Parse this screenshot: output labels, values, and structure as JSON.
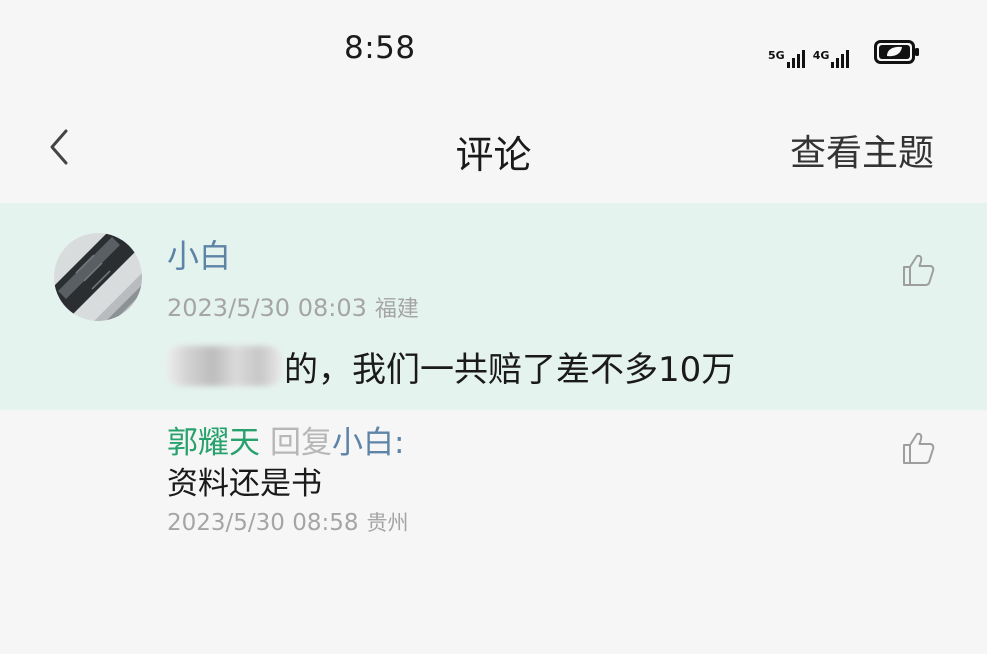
{
  "status_bar": {
    "time": "8:58",
    "signal_1_tag": "5G",
    "signal_2_tag": "4G",
    "battery_icon": "battery-charging-leaf-icon"
  },
  "nav": {
    "back_icon": "chevron-left-icon",
    "title": "评论",
    "action_label": "查看主题"
  },
  "comment": {
    "avatar_icon": "laptop-avatar",
    "author": "小白",
    "date": "2023/5/30 08:03",
    "location": "福建",
    "content_text": "的，我们一共赔了差不多10万",
    "like_icon": "thumbs-up-outline-icon",
    "highlight_color": "#e5f3ee"
  },
  "reply": {
    "author": "郭耀天",
    "reply_word": "回复",
    "target": "小白",
    "colon": ":",
    "text": "资料还是书",
    "date": "2023/5/30 08:58",
    "location": "贵州",
    "like_icon": "thumbs-up-outline-icon",
    "author_color": "#27a26c",
    "link_color": "#5d83a6"
  }
}
